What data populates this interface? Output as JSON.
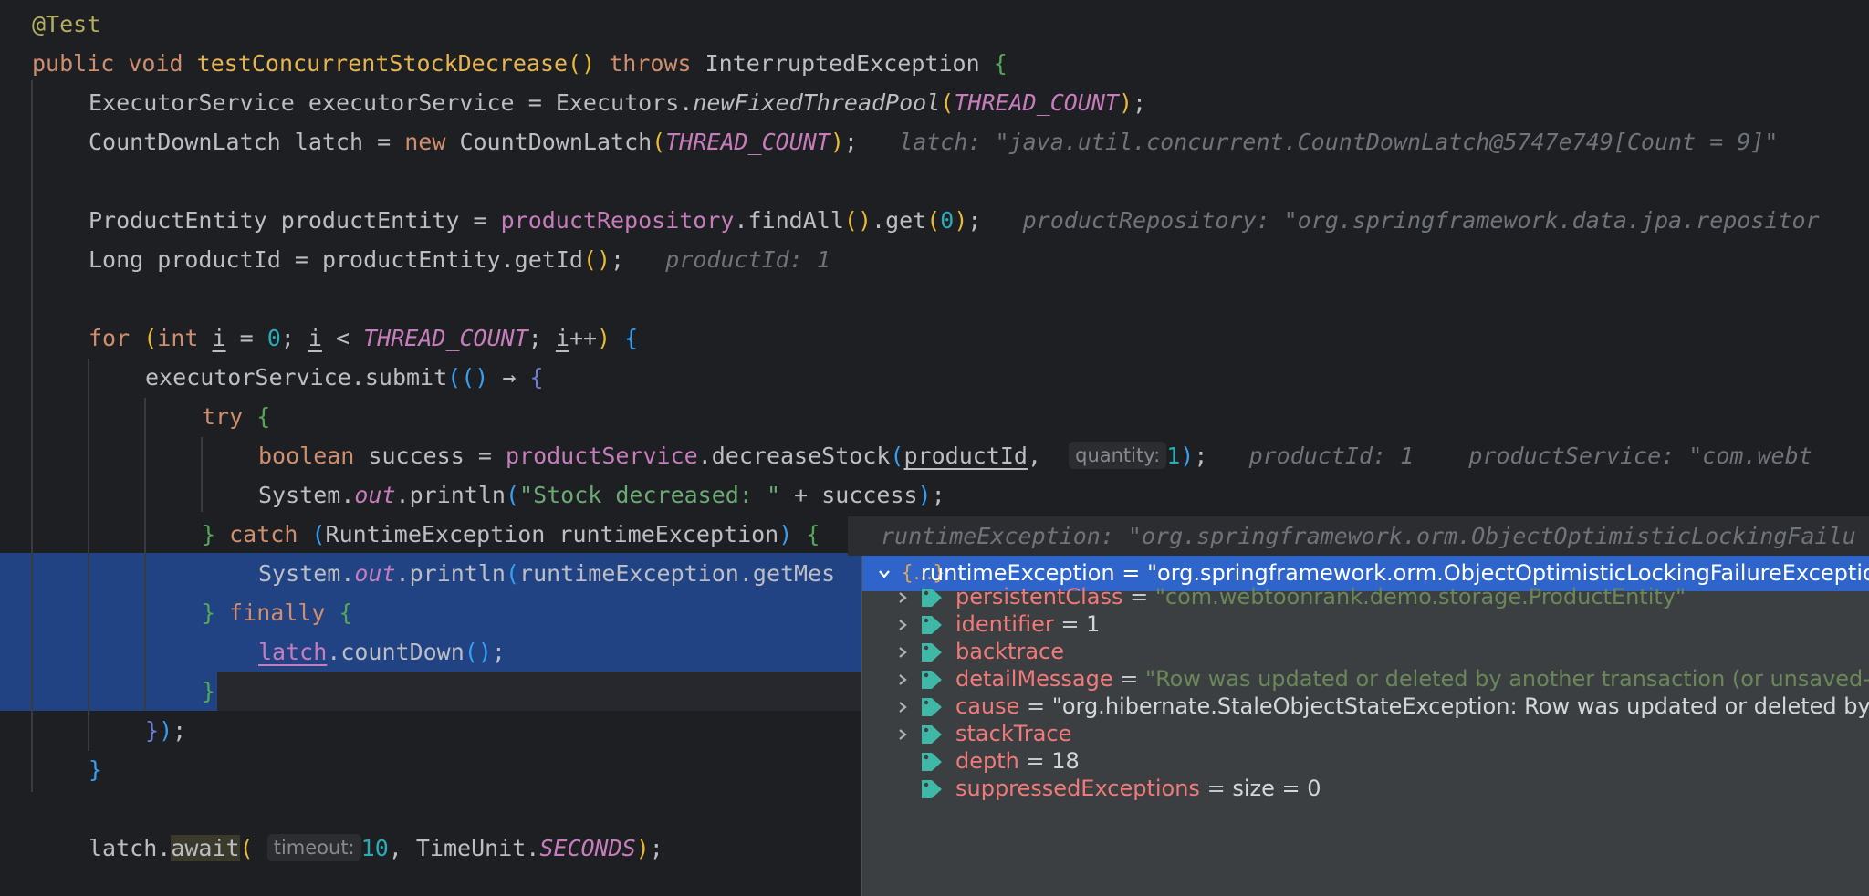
{
  "editor": {
    "l1": {
      "annotation": "@Test"
    },
    "l2": {
      "kw_public": "public",
      "kw_void": "void",
      "method": "testConcurrentStockDecrease",
      "kw_throws": "throws",
      "exception": "InterruptedException"
    },
    "l3": {
      "type": "ExecutorService",
      "var": "executorService",
      "eq": "=",
      "cls": "Executors",
      "call": "newFixedThreadPool",
      "arg": "THREAD_COUNT"
    },
    "l4": {
      "type": "CountDownLatch",
      "var": "latch",
      "eq": "=",
      "kw_new": "new",
      "ctor": "CountDownLatch",
      "arg": "THREAD_COUNT",
      "inline": "latch: \"java.util.concurrent.CountDownLatch@5747e749[Count = 9]\""
    },
    "l6": {
      "type": "ProductEntity",
      "var": "productEntity",
      "eq": "=",
      "field": "productRepository",
      "call1": "findAll",
      "call2": "get",
      "arg": "0",
      "inline": "productRepository: \"org.springframework.data.jpa.repositor"
    },
    "l7": {
      "type": "Long",
      "var": "productId",
      "eq": "=",
      "obj": "productEntity",
      "call": "getId",
      "inline": "productId: 1"
    },
    "l9": {
      "kw_for": "for",
      "kw_int": "int",
      "i": "i",
      "zero": "0",
      "lt": "<",
      "limit": "THREAD_COUNT",
      "inc": "++"
    },
    "l10": {
      "obj": "executorService",
      "call": "submit",
      "arrow": "→"
    },
    "l11": {
      "kw_try": "try"
    },
    "l12": {
      "kw_boolean": "boolean",
      "var": "success",
      "eq": "=",
      "field": "productService",
      "call": "decreaseStock",
      "arg1": "productId",
      "hint": "quantity:",
      "arg2": "1",
      "inline1": "productId: 1",
      "inline2": "productService: \"com.webt"
    },
    "l13": {
      "cls": "System",
      "field": "out",
      "call": "println",
      "str": "\"Stock decreased: \"",
      "plus": "+",
      "var": "success"
    },
    "l14": {
      "kw_catch": "catch",
      "type": "RuntimeException",
      "var": "runtimeException"
    },
    "l15": {
      "cls": "System",
      "field": "out",
      "call": "println",
      "arg": "runtimeException.getMes"
    },
    "l16": {
      "kw_finally": "finally"
    },
    "l17": {
      "var": "latch",
      "call": "countDown"
    },
    "l22": {
      "var": "latch",
      "call": "await",
      "hint": "timeout:",
      "arg": "10",
      "cls": "TimeUnit",
      "const": "SECONDS"
    }
  },
  "popup": {
    "header": "runtimeException: \"org.springframework.orm.ObjectOptimisticLockingFailu",
    "root": {
      "icon": "{...}",
      "name": "runtimeException",
      "eq": "=",
      "value": "\"org.springframework.orm.ObjectOptimisticLockingFailureExceptio"
    },
    "rows": [
      {
        "name": "persistentClass",
        "eq": "=",
        "value": "\"com.webtoonrank.demo.storage.ProductEntity\"",
        "string": true,
        "expandable": true
      },
      {
        "name": "identifier",
        "eq": "=",
        "value": "1",
        "string": false,
        "expandable": true
      },
      {
        "name": "backtrace",
        "eq": "",
        "value": "",
        "string": false,
        "expandable": true
      },
      {
        "name": "detailMessage",
        "eq": "=",
        "value": "\"Row was updated or deleted by another transaction (or unsaved-v",
        "string": true,
        "expandable": true
      },
      {
        "name": "cause",
        "eq": "=",
        "value": "\"org.hibernate.StaleObjectStateException: Row was updated or deleted by",
        "string": false,
        "expandable": true
      },
      {
        "name": "stackTrace",
        "eq": "",
        "value": "",
        "string": false,
        "expandable": true
      },
      {
        "name": "depth",
        "eq": "=",
        "value": "18",
        "string": false,
        "expandable": false
      },
      {
        "name": "suppressedExceptions",
        "eq": "=",
        "value": " size = 0",
        "string": false,
        "expandable": false
      }
    ]
  },
  "icons": [
    "chevron-down-icon",
    "chevron-right-icon",
    "object-icon",
    "field-tag-icon"
  ],
  "colors": {
    "selection": "#214283",
    "popup_selected": "#2f65ca",
    "field_name": "#f07a7a",
    "string": "#6a8759"
  }
}
